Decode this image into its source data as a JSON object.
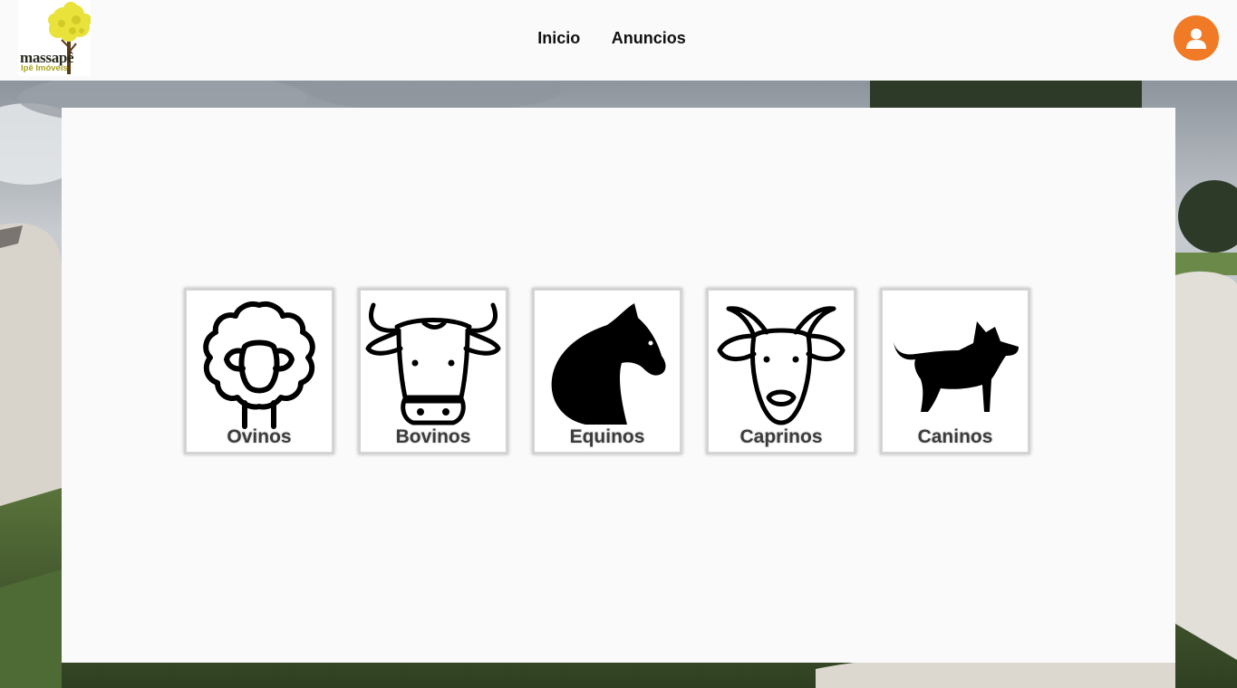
{
  "logo": {
    "name": "massapê",
    "tagline": "Ipê Imóveis"
  },
  "nav": {
    "items": [
      {
        "label": "Inicio"
      },
      {
        "label": "Anuncios"
      }
    ]
  },
  "header": {
    "avatar_icon": "user-icon",
    "avatar_color": "#f07a26"
  },
  "categories": [
    {
      "label": "Ovinos",
      "icon": "sheep-icon"
    },
    {
      "label": "Bovinos",
      "icon": "cow-icon"
    },
    {
      "label": "Equinos",
      "icon": "horse-icon"
    },
    {
      "label": "Caprinos",
      "icon": "goat-icon"
    },
    {
      "label": "Caninos",
      "icon": "dog-icon"
    }
  ]
}
